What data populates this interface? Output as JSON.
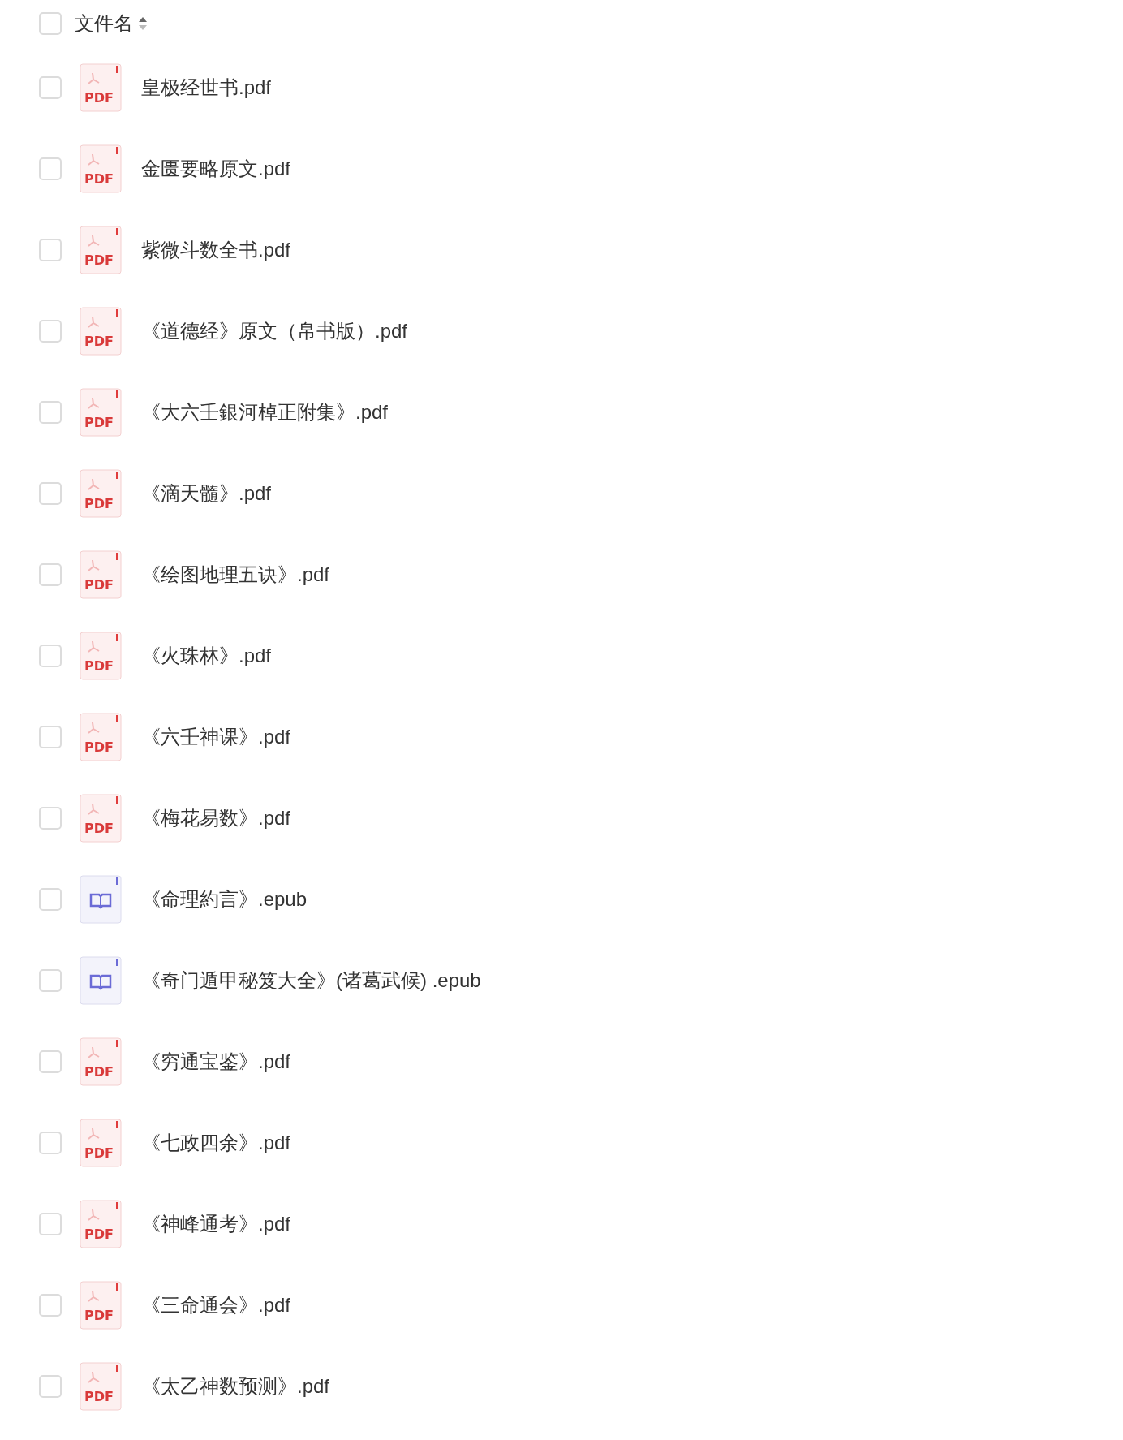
{
  "header": {
    "checked": false,
    "label": "文件名",
    "sort_ascending": true
  },
  "files": [
    {
      "kind": "pdf",
      "badge": "PDF",
      "name": "皇极经世书.pdf",
      "checked": false
    },
    {
      "kind": "pdf",
      "badge": "PDF",
      "name": "金匮要略原文.pdf",
      "checked": false
    },
    {
      "kind": "pdf",
      "badge": "PDF",
      "name": "紫微斗数全书.pdf",
      "checked": false
    },
    {
      "kind": "pdf",
      "badge": "PDF",
      "name": "《道德经》原文（帛书版）.pdf",
      "checked": false
    },
    {
      "kind": "pdf",
      "badge": "PDF",
      "name": "《大六壬銀河棹正附集》.pdf",
      "checked": false
    },
    {
      "kind": "pdf",
      "badge": "PDF",
      "name": "《滴天髓》.pdf",
      "checked": false
    },
    {
      "kind": "pdf",
      "badge": "PDF",
      "name": "《绘图地理五诀》.pdf",
      "checked": false
    },
    {
      "kind": "pdf",
      "badge": "PDF",
      "name": "《火珠林》.pdf",
      "checked": false
    },
    {
      "kind": "pdf",
      "badge": "PDF",
      "name": "《六壬神课》.pdf",
      "checked": false
    },
    {
      "kind": "pdf",
      "badge": "PDF",
      "name": "《梅花易数》.pdf",
      "checked": false
    },
    {
      "kind": "epub",
      "name": "《命理約言》.epub",
      "checked": false
    },
    {
      "kind": "epub",
      "name": "《奇门遁甲秘笈大全》(诸葛武候) .epub",
      "checked": false
    },
    {
      "kind": "pdf",
      "badge": "PDF",
      "name": "《穷通宝鉴》.pdf",
      "checked": false
    },
    {
      "kind": "pdf",
      "badge": "PDF",
      "name": "《七政四余》.pdf",
      "checked": false
    },
    {
      "kind": "pdf",
      "badge": "PDF",
      "name": "《神峰通考》.pdf",
      "checked": false
    },
    {
      "kind": "pdf",
      "badge": "PDF",
      "name": "《三命通会》.pdf",
      "checked": false
    },
    {
      "kind": "pdf",
      "badge": "PDF",
      "name": "《太乙神数预测》.pdf",
      "checked": false
    }
  ]
}
